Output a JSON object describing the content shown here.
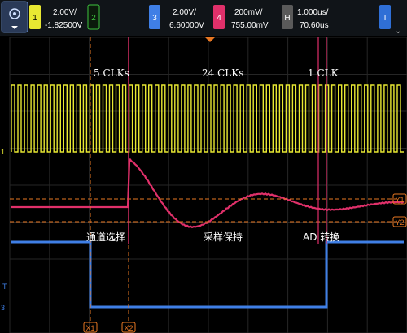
{
  "toolbar": {
    "menu_icon": "oscilloscope-logo-icon",
    "channels": [
      {
        "num": "1",
        "scale": "2.00V/",
        "offset": "-1.82500V",
        "color": "#e8e832"
      },
      {
        "num": "2",
        "scale": "",
        "offset": "",
        "color": "#3ec43e"
      },
      {
        "num": "3",
        "scale": "2.00V/",
        "offset": "6.60000V",
        "color": "#3f7fe6"
      },
      {
        "num": "4",
        "scale": "200mV/",
        "offset": "755.00mV",
        "color": "#e0306a"
      }
    ],
    "timebase": {
      "key": "H",
      "scale": "1.000us/",
      "delay": "70.60us"
    },
    "trigger": {
      "key": "T"
    }
  },
  "annotations": {
    "clks_5": "5 CLKs",
    "clks_24": "24 CLKs",
    "clk_1": "1 CLK",
    "channel_select": "通道选择",
    "sample_hold": "采样保持",
    "ad_convert": "AD 转换"
  },
  "markers": {
    "x1": "X1",
    "x2": "X2",
    "y1": "Y1",
    "y2": "Y2"
  },
  "left_labels": {
    "ch1": "1",
    "ch3": "3",
    "trig": "T"
  },
  "colors": {
    "ch1": "#e8e832",
    "ch3": "#3f7fe6",
    "ch4": "#e0306a",
    "cursor": "#e87722",
    "grid": "#2a2a2a"
  },
  "chart_data": {
    "type": "line",
    "series": [
      {
        "name": "1",
        "description_values": {
          "signal": "clock square wave",
          "cycles_visible": 60
        }
      },
      {
        "name": "4",
        "values": [
          {
            "t_us": -0.6,
            "v": 0
          },
          {
            "t_us": 0,
            "v": 0
          },
          {
            "t_us": 0.1,
            "v": 0.9
          },
          {
            "t_us": 2.5,
            "v": -0.3
          },
          {
            "t_us": 3.8,
            "v": 0.25
          },
          {
            "t_us": 5.2,
            "v": -0.1
          },
          {
            "t_us": 6.4,
            "v": 0.12
          },
          {
            "t_us": 10,
            "v": 0.04
          }
        ]
      },
      {
        "name": "3",
        "values": [
          {
            "t_us": -0.6,
            "v": 1
          },
          {
            "t_us": 0,
            "v": 0
          },
          {
            "t_us": 7.3,
            "v": 0
          },
          {
            "t_us": 7.4,
            "v": 1
          }
        ]
      }
    ]
  }
}
